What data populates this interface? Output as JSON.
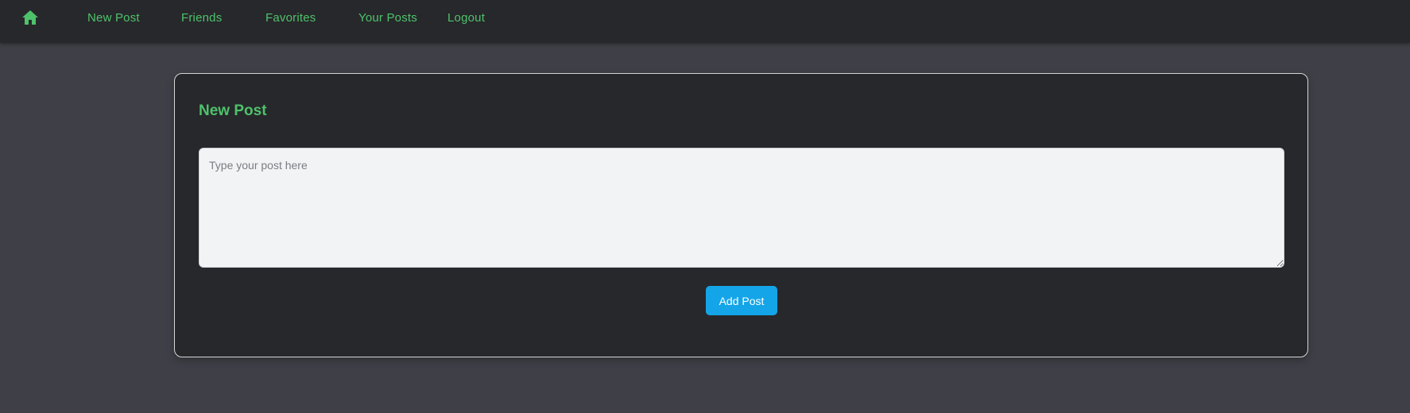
{
  "colors": {
    "page_background": "#3f4047",
    "navbar_background": "#27282b",
    "card_background": "#27282b",
    "accent_green": "#4ec26b",
    "button_blue": "#14a5e8",
    "input_background": "#f2f3f5",
    "card_border": "#d6d6d6"
  },
  "navbar": {
    "home_icon": "home-icon",
    "links": [
      {
        "label": "New Post"
      },
      {
        "label": "Friends"
      },
      {
        "label": "Favorites"
      },
      {
        "label": "Your Posts"
      },
      {
        "label": "Logout"
      }
    ]
  },
  "new_post_card": {
    "title": "New Post",
    "input": {
      "placeholder": "Type your post here",
      "value": ""
    },
    "submit_label": "Add Post"
  }
}
